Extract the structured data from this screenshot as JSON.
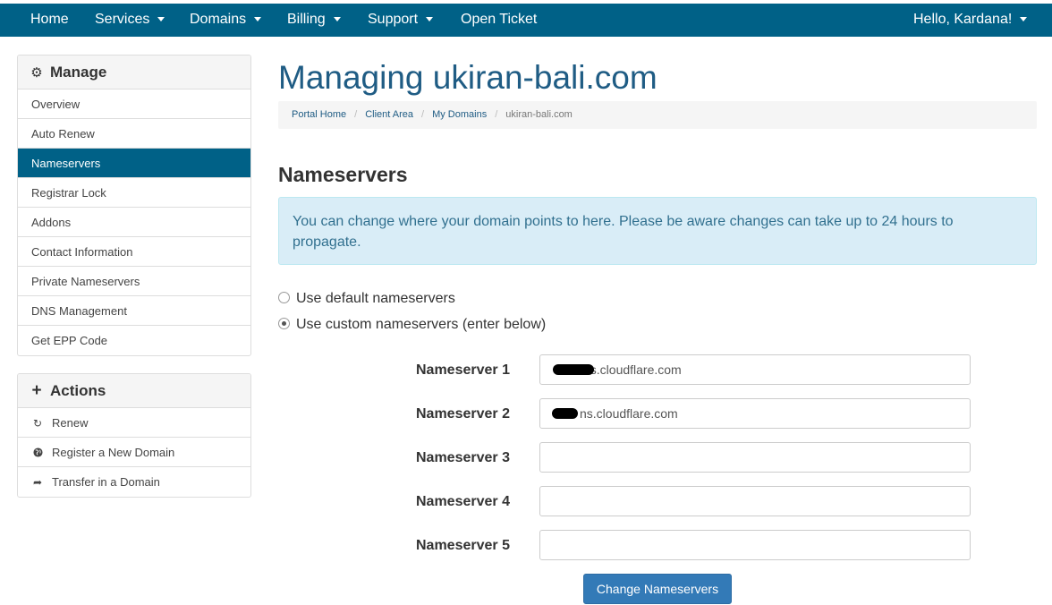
{
  "nav": {
    "home": "Home",
    "services": "Services",
    "domains": "Domains",
    "billing": "Billing",
    "support": "Support",
    "open_ticket": "Open Ticket",
    "user_greeting": "Hello, Kardana!"
  },
  "sidebar": {
    "manage": {
      "title": "Manage",
      "icon": "gear-icon",
      "items": [
        {
          "label": "Overview"
        },
        {
          "label": "Auto Renew"
        },
        {
          "label": "Nameservers",
          "active": true
        },
        {
          "label": "Registrar Lock"
        },
        {
          "label": "Addons"
        },
        {
          "label": "Contact Information"
        },
        {
          "label": "Private Nameservers"
        },
        {
          "label": "DNS Management"
        },
        {
          "label": "Get EPP Code"
        }
      ]
    },
    "actions": {
      "title": "Actions",
      "icon": "plus-icon",
      "items": [
        {
          "label": "Renew",
          "icon": "refresh-icon"
        },
        {
          "label": "Register a New Domain",
          "icon": "globe-icon"
        },
        {
          "label": "Transfer in a Domain",
          "icon": "share-arrow-icon"
        }
      ]
    }
  },
  "main": {
    "title": "Managing ukiran-bali.com",
    "breadcrumb": [
      "Portal Home",
      "Client Area",
      "My Domains",
      "ukiran-bali.com"
    ],
    "section_title": "Nameservers",
    "info": "You can change where your domain points to here. Please be aware changes can take up to 24 hours to propagate.",
    "options": [
      {
        "label": "Use default nameservers",
        "selected": false
      },
      {
        "label": "Use custom nameservers (enter below)",
        "selected": true
      }
    ],
    "nameservers": [
      {
        "label": "Nameserver 1",
        "value": "ns.cloudflare.com"
      },
      {
        "label": "Nameserver 2",
        "value": "ns.cloudflare.com"
      },
      {
        "label": "Nameserver 3",
        "value": ""
      },
      {
        "label": "Nameserver 4",
        "value": ""
      },
      {
        "label": "Nameserver 5",
        "value": ""
      }
    ],
    "submit_label": "Change Nameservers"
  },
  "colors": {
    "nav_bg": "#006187",
    "active_item": "#006187",
    "title_blue": "#1f5c84",
    "alert_bg": "#d9edf7",
    "alert_text": "#31708f",
    "button": "#337ab7"
  }
}
